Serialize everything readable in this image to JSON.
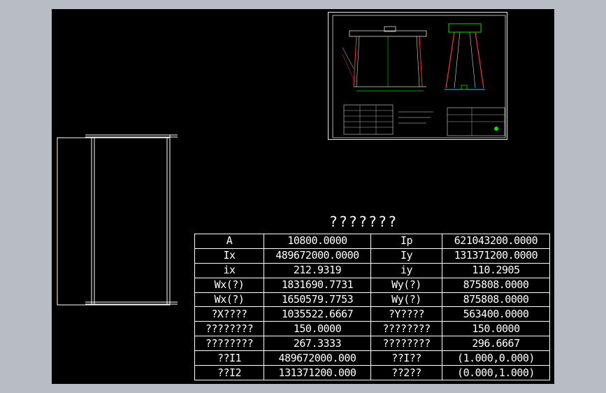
{
  "table": {
    "title": "???????",
    "rows": [
      {
        "l1": "A",
        "v1": "10800.0000",
        "l2": "Ip",
        "v2": "621043200.0000"
      },
      {
        "l1": "Ix",
        "v1": "489672000.0000",
        "l2": "Iy",
        "v2": "131371200.0000"
      },
      {
        "l1": "ix",
        "v1": "212.9319",
        "l2": "iy",
        "v2": "110.2905"
      },
      {
        "l1": "Wx(?)",
        "v1": "1831690.7731",
        "l2": "Wy(?)",
        "v2": "875808.0000"
      },
      {
        "l1": "Wx(?)",
        "v1": "1650579.7753",
        "l2": "Wy(?)",
        "v2": "875808.0000"
      },
      {
        "l1": "?X????",
        "v1": "1035522.6667",
        "l2": "?Y????",
        "v2": "563400.0000"
      },
      {
        "l1": "????????",
        "v1": "150.0000",
        "l2": "????????",
        "v2": "150.0000"
      },
      {
        "l1": "????????",
        "v1": "267.3333",
        "l2": "????????",
        "v2": "296.6667"
      },
      {
        "l1": "??I1",
        "v1": "489672000.000",
        "l2": "??I??",
        "v2": "(1.000,0.000)"
      },
      {
        "l1": "??I2",
        "v1": "131371200.000",
        "l2": "??2??",
        "v2": "(0.000,1.000)"
      }
    ]
  },
  "colors": {
    "canvas": "#000000",
    "background": "#b8bcc3",
    "lines": "#ffffff",
    "accent_red": "#ff3030",
    "accent_green": "#00e000",
    "accent_cyan": "#00d8ff"
  }
}
